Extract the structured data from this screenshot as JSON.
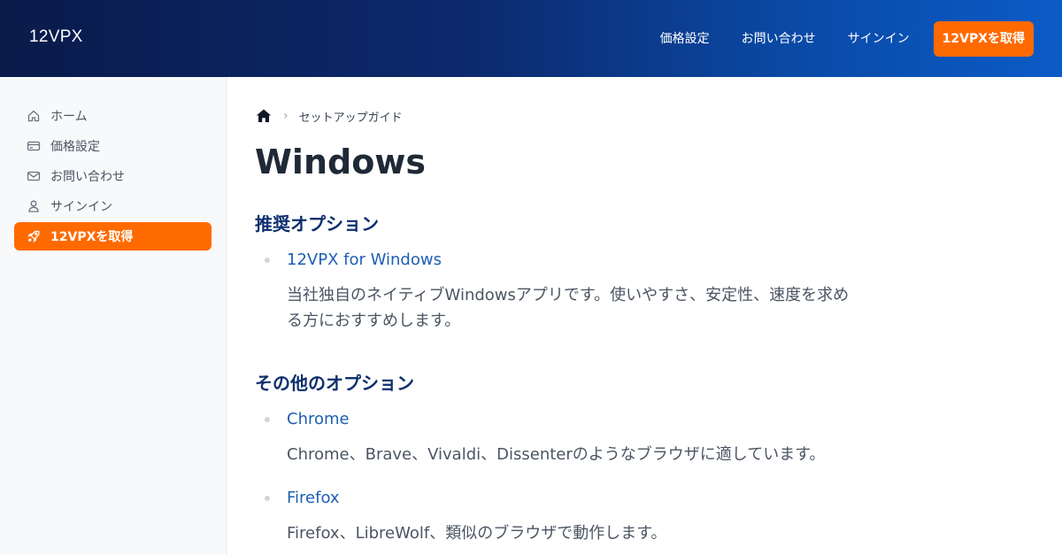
{
  "header": {
    "brand": "12VPX",
    "nav": {
      "pricing": "価格設定",
      "contact": "お問い合わせ",
      "signin": "サインイン",
      "cta": "12VPXを取得"
    }
  },
  "sidebar": {
    "items": [
      {
        "label": "ホーム",
        "icon": "home-icon"
      },
      {
        "label": "価格設定",
        "icon": "card-icon"
      },
      {
        "label": "お問い合わせ",
        "icon": "mail-icon"
      },
      {
        "label": "サインイン",
        "icon": "user-icon"
      },
      {
        "label": "12VPXを取得",
        "icon": "rocket-icon"
      }
    ]
  },
  "breadcrumb": {
    "current": "セットアップガイド"
  },
  "page": {
    "title": "Windows",
    "recommended": {
      "heading": "推奨オプション",
      "items": [
        {
          "name": "12VPX for Windows",
          "desc": "当社独自のネイティブWindowsアプリです。使いやすさ、安定性、速度を求める方におすすめします。"
        }
      ]
    },
    "other": {
      "heading": "その他のオプション",
      "items": [
        {
          "name": "Chrome",
          "desc": "Chrome、Brave、Vivaldi、Dissenterのようなブラウザに適しています。"
        },
        {
          "name": "Firefox",
          "desc": "Firefox、LibreWolf、類似のブラウザで動作します。"
        }
      ]
    }
  },
  "colors": {
    "accent": "#ff6a00",
    "link": "#1e5fb4",
    "heading": "#0c2f6e"
  }
}
